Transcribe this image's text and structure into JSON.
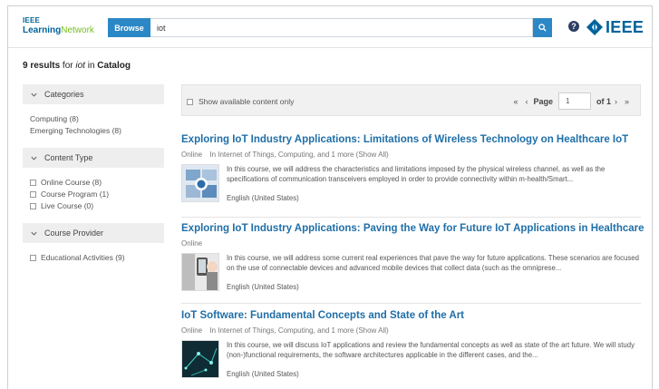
{
  "header": {
    "logo": {
      "ieee": "IEEE",
      "learning": "Learning",
      "network": "Network"
    },
    "browse_label": "Browse",
    "search_value": "iot",
    "help_label": "?",
    "ieee_wordmark": "IEEE"
  },
  "summary": {
    "count": "9 results",
    "for": "for",
    "query": "iot",
    "in": "in",
    "scope": "Catalog"
  },
  "sidebar": {
    "facets": [
      {
        "label": "Categories",
        "type": "links",
        "items": [
          "Computing (8)",
          "Emerging Technologies (8)"
        ]
      },
      {
        "label": "Content Type",
        "type": "checks",
        "items": [
          "Online Course (8)",
          "Course Program (1)",
          "Live Course (0)"
        ]
      },
      {
        "label": "Course Provider",
        "type": "checks",
        "items": [
          "Educational Activities (9)"
        ]
      }
    ]
  },
  "toolbar": {
    "show_available": "Show available content only",
    "first": "«",
    "prev": "‹",
    "page_label": "Page",
    "page_value": "1",
    "of_label": "of 1",
    "next": "›",
    "last": "»"
  },
  "results": [
    {
      "title": "Exploring IoT Industry Applications: Limitations of Wireless Technology on Healthcare IoT",
      "format": "Online",
      "categories": "In Internet of Things, Computing, and 1 more",
      "show_all": "(Show All)",
      "description": "In this course, we will address the characteristics and limitations imposed by the physical wireless channel, as well as the specifications of communication transceivers employed in order to provide connectivity within m-health/Smart...",
      "language": "English (United States)"
    },
    {
      "title": "Exploring IoT Industry Applications: Paving the Way for Future IoT Applications in Healthcare",
      "format": "Online",
      "categories": "",
      "show_all": "",
      "description": "In this course, we will address some current real experiences that pave the way for future applications. These scenarios are focused on the use of connectable devices and advanced mobile devices that collect data (such as the omnipresе...",
      "language": "English (United States)"
    },
    {
      "title": "IoT Software: Fundamental Concepts and State of the Art",
      "format": "Online",
      "categories": "In Internet of Things, Computing, and 1 more",
      "show_all": "(Show All)",
      "description": "In this course, we will discuss IoT applications and review the fundamental concepts as well as state of the art future. We will study (non-)functional requirements, the software architectures applicable in the different cases, and the...",
      "language": "English (United States)"
    }
  ],
  "colors": {
    "accent": "#2b87c5",
    "title_link": "#1f6fa8",
    "ieee_blue": "#00629b",
    "green": "#78be20"
  }
}
